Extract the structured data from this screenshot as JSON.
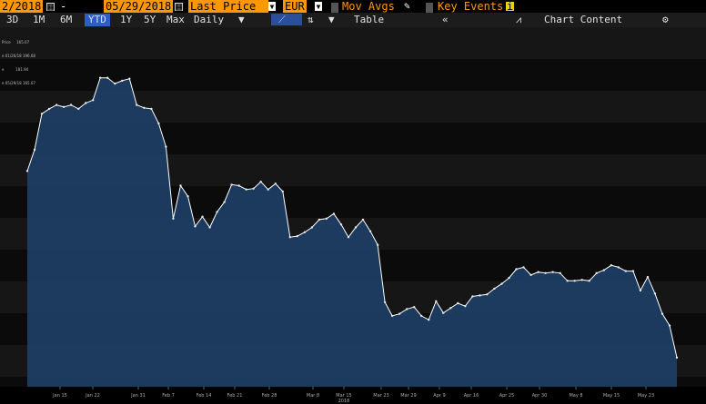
{
  "toolbar": {
    "start_date": "2/2018",
    "dash": "-",
    "end_date": "05/29/2018",
    "field": "Last Price",
    "currency": "EUR",
    "mov_avgs": "Mov Avgs",
    "key_events": "Key Events",
    "key_events_badge": "i"
  },
  "range_bar": {
    "ranges": [
      "3D",
      "1M",
      "6M",
      "YTD",
      "1Y",
      "5Y",
      "Max"
    ],
    "selected": "YTD",
    "frequency": "Daily",
    "table_label": "Table",
    "collapse_glyph": "«",
    "chart_content": "Chart Content",
    "gear": "⚙"
  },
  "legend": {
    "lines": [
      "Price     165.07",
      "e 01/26/18 196.68",
      "e          181.94",
      "e 05/29/18 165.07"
    ]
  },
  "colors": {
    "accent_orange": "#ff9800",
    "selected_blue": "#2b5fc7",
    "area_fill": "#1c3d63",
    "line": "#ffffff"
  },
  "chart_data": {
    "type": "area",
    "title": "",
    "xlabel": "",
    "ylabel": "",
    "x_ticks": [
      "Jan 15",
      "Jan 22",
      "Jan 31",
      "Feb 7",
      "Feb 14",
      "Feb 21",
      "Feb 28",
      "Mar 8",
      "Mar 15",
      "Mar 23",
      "Mar 29",
      "Apr 9",
      "Apr 16",
      "Apr 25",
      "Apr 30",
      "May 8",
      "May 15",
      "May 23"
    ],
    "year_label": "2018",
    "ylim": [
      163,
      200
    ],
    "values": [
      185.2,
      187.4,
      191.1,
      191.6,
      192.0,
      191.8,
      192.0,
      191.6,
      192.2,
      192.5,
      194.8,
      194.8,
      194.2,
      194.5,
      194.7,
      192.0,
      191.7,
      191.6,
      190.1,
      187.7,
      180.3,
      183.7,
      182.6,
      179.5,
      180.5,
      179.4,
      181.0,
      182.0,
      183.8,
      183.7,
      183.3,
      183.4,
      184.1,
      183.3,
      183.9,
      183.1,
      178.4,
      178.5,
      178.9,
      179.4,
      180.2,
      180.3,
      180.8,
      179.7,
      178.4,
      179.4,
      180.2,
      179.0,
      177.6,
      171.7,
      170.3,
      170.5,
      171.0,
      171.2,
      170.3,
      169.9,
      171.8,
      170.6,
      171.1,
      171.6,
      171.3,
      172.3,
      172.4,
      172.5,
      173.1,
      173.6,
      174.2,
      175.1,
      175.3,
      174.5,
      174.8,
      174.7,
      174.8,
      174.7,
      173.9,
      173.9,
      174.0,
      173.9,
      174.7,
      175.0,
      175.5,
      175.3,
      174.9,
      174.9,
      172.9,
      174.3,
      172.6,
      170.5,
      169.3,
      166.0
    ]
  }
}
